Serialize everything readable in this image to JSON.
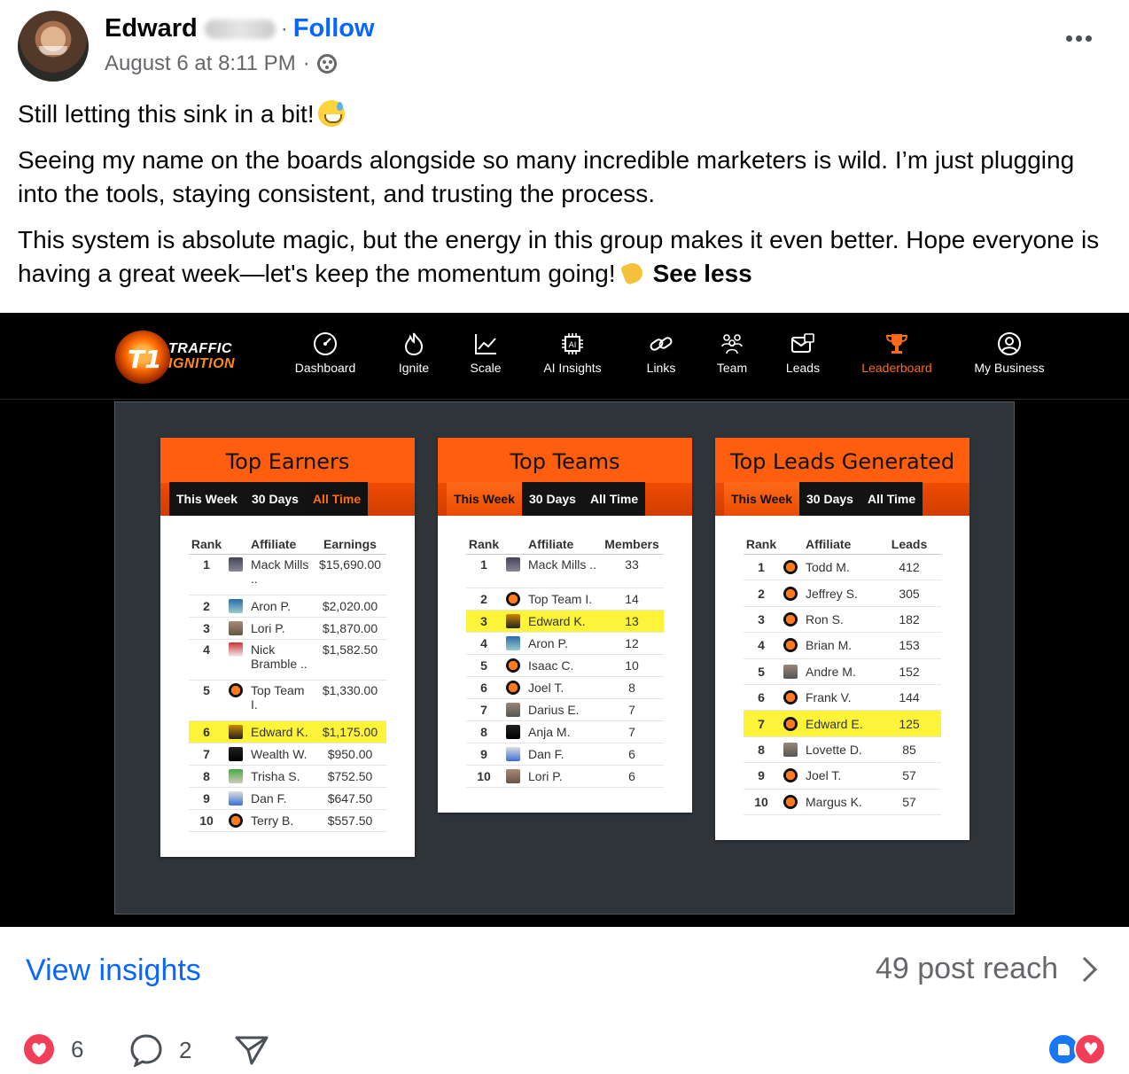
{
  "post": {
    "author_first": "Edward",
    "follow_label": "Follow",
    "separator": "·",
    "timestamp": "August 6 at 8:11 PM",
    "meta_dot": "·",
    "paragraphs": [
      "Still letting this sink in a bit!",
      "Seeing my name on the boards alongside so many incredible marketers is wild. I’m just plugging into the tools, staying consistent, and trusting the process.",
      "This system is absolute magic, but the energy in this group makes it even better. Hope everyone is having a great week—let's keep the momentum going!"
    ],
    "see_less": "See less"
  },
  "app": {
    "logo_line1": "TRAFFIC",
    "logo_line2": "IGNITION",
    "logo_mark": "T1",
    "nav": [
      {
        "label": "Dashboard",
        "icon": "gauge-icon"
      },
      {
        "label": "Ignite",
        "icon": "flame-icon"
      },
      {
        "label": "Scale",
        "icon": "chart-up-icon"
      },
      {
        "label": "AI Insights",
        "icon": "ai-chip-icon"
      },
      {
        "label": "Links",
        "icon": "link-icon"
      },
      {
        "label": "Team",
        "icon": "team-icon"
      },
      {
        "label": "Leads",
        "icon": "leads-icon"
      },
      {
        "label": "Leaderboard",
        "icon": "trophy-icon",
        "active": true
      },
      {
        "label": "My Business",
        "icon": "user-circle-icon"
      }
    ],
    "accent": "#ff6a1a",
    "highlight": "#fdf43a",
    "boards": [
      {
        "title": "Top Earners",
        "tabs": [
          "This Week",
          "30 Days",
          "All Time"
        ],
        "active_tab": "All Time",
        "columns": [
          "Rank",
          "Affiliate",
          "Earnings"
        ],
        "rows": [
          {
            "rank": "1",
            "name": "Mack Mills ..",
            "value": "$15,690.00"
          },
          {
            "rank": "2",
            "name": "Aron P.",
            "value": "$2,020.00"
          },
          {
            "rank": "3",
            "name": "Lori P.",
            "value": "$1,870.00"
          },
          {
            "rank": "4",
            "name": "Nick Bramble ..",
            "value": "$1,582.50"
          },
          {
            "rank": "5",
            "name": "Top Team I.",
            "value": "$1,330.00"
          },
          {
            "rank": "6",
            "name": "Edward K.",
            "value": "$1,175.00",
            "highlight": true
          },
          {
            "rank": "7",
            "name": "Wealth W.",
            "value": "$950.00"
          },
          {
            "rank": "8",
            "name": "Trisha S.",
            "value": "$752.50"
          },
          {
            "rank": "9",
            "name": "Dan F.",
            "value": "$647.50"
          },
          {
            "rank": "10",
            "name": "Terry B.",
            "value": "$557.50"
          }
        ]
      },
      {
        "title": "Top Teams",
        "tabs": [
          "This Week",
          "30 Days",
          "All Time"
        ],
        "active_tab": "This Week",
        "columns": [
          "Rank",
          "Affiliate",
          "Members"
        ],
        "rows": [
          {
            "rank": "1",
            "name": "Mack Mills ..",
            "value": "33"
          },
          {
            "rank": "2",
            "name": "Top Team I.",
            "value": "14"
          },
          {
            "rank": "3",
            "name": "Edward K.",
            "value": "13",
            "highlight": true
          },
          {
            "rank": "4",
            "name": "Aron P.",
            "value": "12"
          },
          {
            "rank": "5",
            "name": "Isaac C.",
            "value": "10"
          },
          {
            "rank": "6",
            "name": "Joel T.",
            "value": "8"
          },
          {
            "rank": "7",
            "name": "Darius E.",
            "value": "7"
          },
          {
            "rank": "8",
            "name": "Anja M.",
            "value": "7"
          },
          {
            "rank": "9",
            "name": "Dan F.",
            "value": "6"
          },
          {
            "rank": "10",
            "name": "Lori P.",
            "value": "6"
          }
        ]
      },
      {
        "title": "Top Leads Generated",
        "tabs": [
          "This Week",
          "30 Days",
          "All Time"
        ],
        "active_tab": "This Week",
        "columns": [
          "Rank",
          "Affiliate",
          "Leads"
        ],
        "rows": [
          {
            "rank": "1",
            "name": "Todd M.",
            "value": "412"
          },
          {
            "rank": "2",
            "name": "Jeffrey S.",
            "value": "305"
          },
          {
            "rank": "3",
            "name": "Ron S.",
            "value": "182"
          },
          {
            "rank": "4",
            "name": "Brian M.",
            "value": "153"
          },
          {
            "rank": "5",
            "name": "Andre M.",
            "value": "152"
          },
          {
            "rank": "6",
            "name": "Frank V.",
            "value": "144"
          },
          {
            "rank": "7",
            "name": "Edward E.",
            "value": "125",
            "highlight": true
          },
          {
            "rank": "8",
            "name": "Lovette D.",
            "value": "85"
          },
          {
            "rank": "9",
            "name": "Joel T.",
            "value": "57"
          },
          {
            "rank": "10",
            "name": "Margus K.",
            "value": "57"
          }
        ]
      }
    ]
  },
  "footer": {
    "view_insights": "View insights",
    "post_reach": "49 post reach",
    "love_count": "6",
    "comment_count": "2"
  }
}
